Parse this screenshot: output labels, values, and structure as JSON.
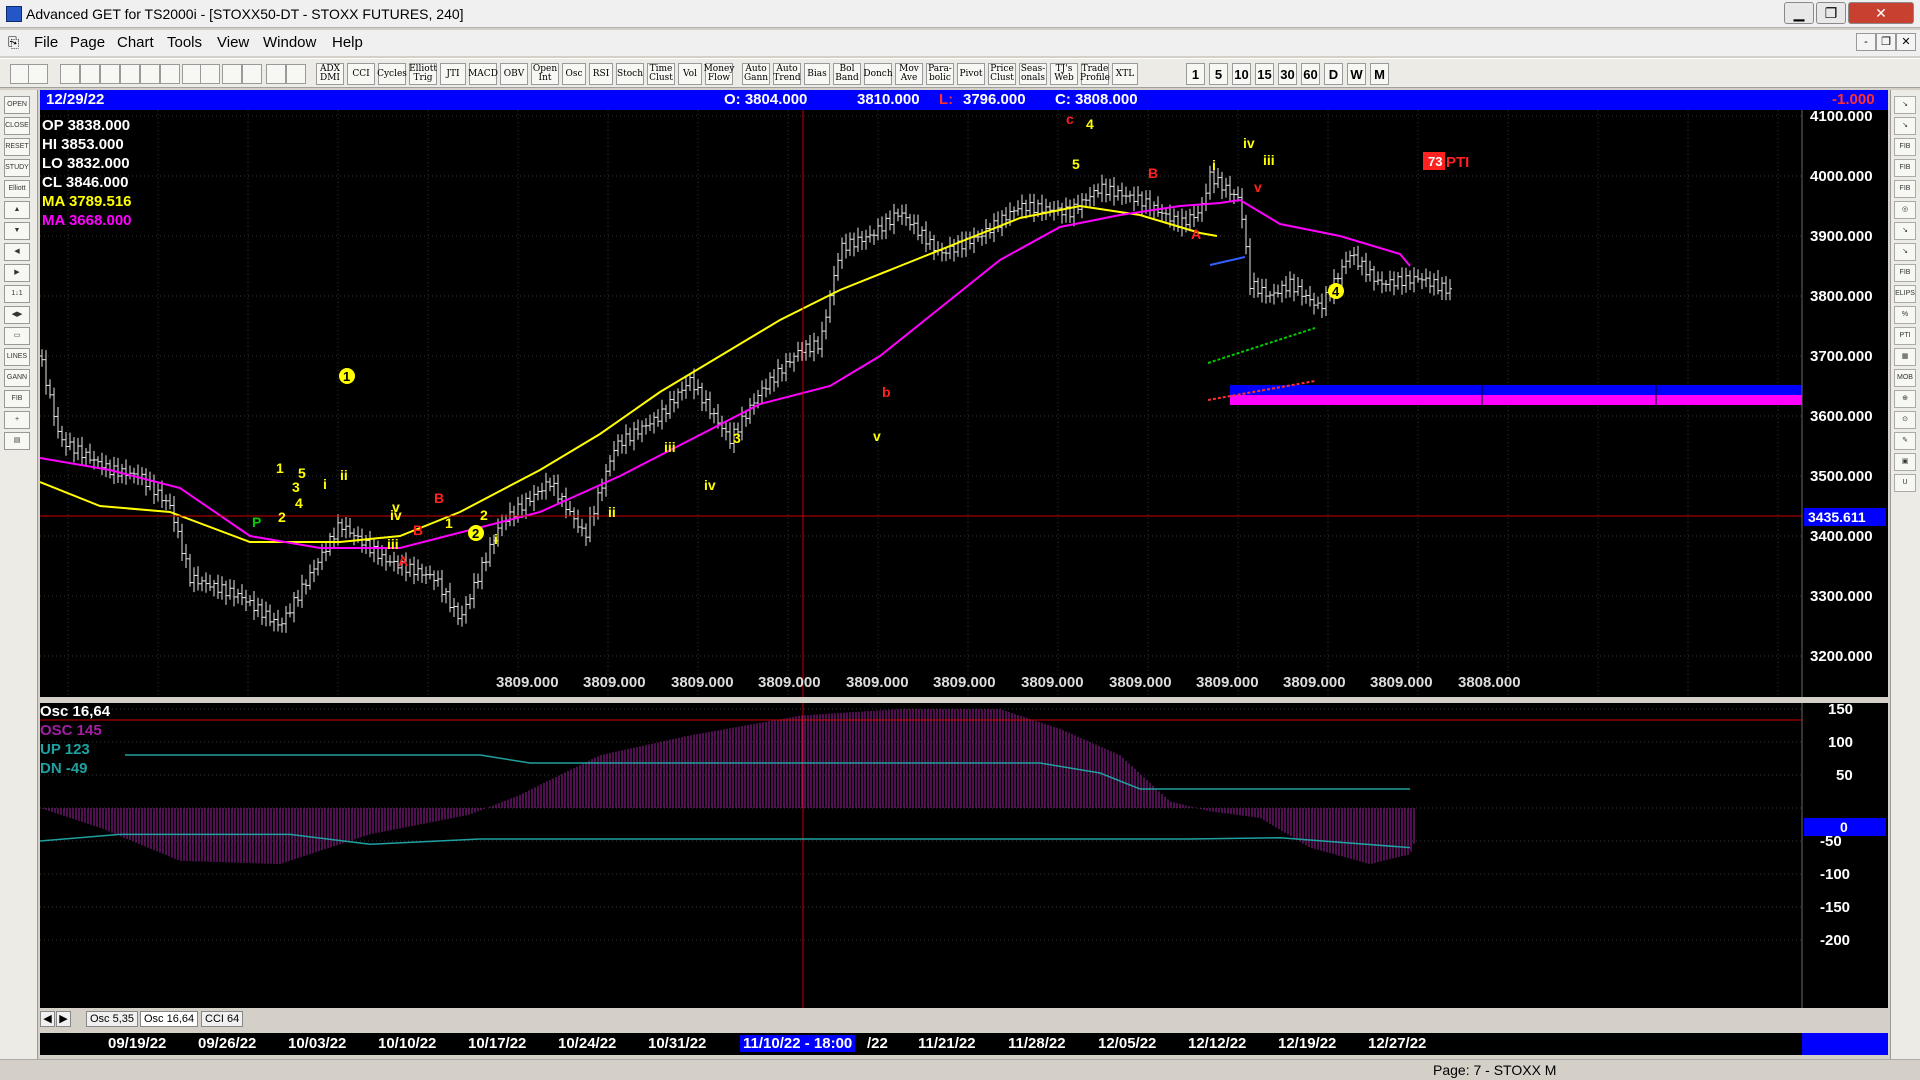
{
  "window": {
    "title": "Advanced GET for TS2000i - [STOXX50-DT - STOXX FUTURES, 240]",
    "min": "▁",
    "max": "❐",
    "close": "✕",
    "mdi_min": "-",
    "mdi_restore": "❐",
    "mdi_close": "✕"
  },
  "menu": [
    "File",
    "Page",
    "Chart",
    "Tools",
    "View",
    "Window",
    "Help"
  ],
  "toolbar": {
    "buttons": [
      "ADX DMI",
      "CCI",
      "Cycles",
      "Elliott Trig",
      "JTI",
      "MACD",
      "OBV",
      "Open Int",
      "Osc",
      "RSI",
      "Stoch",
      "Time Clust",
      "Vol",
      "Money Flow",
      "Auto Gann",
      "Auto Trend",
      "Bias",
      "Bol Band",
      "Donch",
      "Mov Ave",
      "Para-bolic",
      "Pivot",
      "Price Clust",
      "Seas-onals",
      "TJ's Web",
      "Trade Profile",
      "XTL"
    ],
    "intervals": [
      "1",
      "5",
      "10",
      "15",
      "30",
      "60",
      "D",
      "W",
      "M"
    ]
  },
  "left_tools": [
    "OPEN",
    "CLOSE",
    "RESET",
    "STUDY",
    "Elliott",
    "▲",
    "▼",
    "◀",
    "▶",
    "1↓1",
    "◀▶",
    "▭",
    "LINES",
    "GANN",
    "FIB",
    "+",
    "▤"
  ],
  "right_tools": [
    "↘",
    "↘",
    "FIB RET",
    "FIB EXT",
    "FIB TIME",
    "◎",
    "↘",
    "↘",
    "FIB",
    "ELIPS",
    "%",
    "PTI",
    "▦",
    "MOB",
    "⊕",
    "⊙",
    "✎",
    "▣",
    "U"
  ],
  "header": {
    "date": "12/29/22",
    "open": "O: 3804.000",
    "high": "3810.000",
    "low_label": "L:",
    "low": "3796.000",
    "close": "C: 3808.000",
    "change": "-1.000"
  },
  "info": {
    "op": "OP  3838.000",
    "hi": "HI   3853.000",
    "lo": "LO  3832.000",
    "cl": "CL  3846.000",
    "ma1": "MA  3789.516",
    "ma2": "MA  3668.000"
  },
  "price_axis": {
    "labels": [
      "4100.000",
      "4000.000",
      "3900.000",
      "3800.000",
      "3700.000",
      "3600.000",
      "3500.000",
      "3400.000",
      "3300.000",
      "3200.000"
    ],
    "cursor": "3435.611"
  },
  "bottom_vals": [
    "3809.000",
    "3809.000",
    "3809.000",
    "3809.000",
    "3809.000",
    "3809.000",
    "3809.000",
    "3809.000",
    "3809.000",
    "3809.000",
    "3809.000",
    "3808.000"
  ],
  "pti": {
    "value": "73",
    "label": "PTI"
  },
  "osc": {
    "title": "Osc 16,64",
    "osc": "OSC 145",
    "up": "UP   123",
    "dn": "DN   -49",
    "axis": [
      "150",
      "100",
      "50",
      "0",
      "-50",
      "-100",
      "-150",
      "-200"
    ],
    "zero": "0"
  },
  "tabs": [
    "Osc 5,35",
    "Osc 16,64",
    "CCI 64"
  ],
  "dates": [
    "09/19/22",
    "09/26/22",
    "10/03/22",
    "10/10/22",
    "10/17/22",
    "10/24/22",
    "10/31/22",
    "11/10/22 - 18:00",
    "/22",
    "11/21/22",
    "11/28/22",
    "12/05/22",
    "12/12/22",
    "12/19/22",
    "12/27/22"
  ],
  "status": "Page: 7 - STOXX M",
  "colors": {
    "chart_bg": "#000000",
    "header_bg": "#0000ff",
    "ma_fast": "#ffff00",
    "ma_slow": "#ff00ff",
    "osc": "#a020a0",
    "wave_yellow": "#ffff00",
    "wave_red": "#ff2020",
    "wave_green": "#00cc00",
    "cursor_line": "#cc0000"
  },
  "waves": [
    {
      "t": "P",
      "c": "#00cc00"
    },
    {
      "t": "2",
      "c": "#ffff00"
    },
    {
      "t": "1",
      "c": "#ffff00"
    },
    {
      "t": "3",
      "c": "#ffff00"
    },
    {
      "t": "4",
      "c": "#ffff00"
    },
    {
      "t": "5",
      "c": "#ffff00"
    },
    {
      "t": "ii",
      "c": "#ffff00"
    },
    {
      "t": "i",
      "c": "#ffff00"
    },
    {
      "t": "iv",
      "c": "#ffff00"
    },
    {
      "t": "iii",
      "c": "#ffff00"
    },
    {
      "t": "v",
      "c": "#ffff00"
    },
    {
      "t": "A",
      "c": "#ff2020"
    },
    {
      "t": "B",
      "c": "#ff2020"
    },
    {
      "t": "B",
      "c": "#ff2020"
    },
    {
      "t": "1",
      "c": "#ffff00"
    },
    {
      "t": "2",
      "c": "#ffff00"
    },
    {
      "t": "i",
      "c": "#ffff00"
    },
    {
      "t": "ii",
      "c": "#ffff00"
    },
    {
      "t": "iii",
      "c": "#ffff00"
    },
    {
      "t": "iv",
      "c": "#ffff00"
    },
    {
      "t": "3",
      "c": "#ffff00"
    },
    {
      "t": "v",
      "c": "#ffff00"
    },
    {
      "t": "b",
      "c": "#ff2020"
    },
    {
      "t": "a",
      "c": "#ff2020"
    },
    {
      "t": "c",
      "c": "#ff2020"
    },
    {
      "t": "4",
      "c": "#ffff00"
    },
    {
      "t": "5",
      "c": "#ffff00"
    },
    {
      "t": "B",
      "c": "#ff2020"
    },
    {
      "t": "A",
      "c": "#ff2020"
    },
    {
      "t": "ii",
      "c": "#ffff00"
    },
    {
      "t": "i",
      "c": "#ffff00"
    },
    {
      "t": "iv",
      "c": "#ffff00"
    },
    {
      "t": "iii",
      "c": "#ffff00"
    },
    {
      "t": "v",
      "c": "#ff2020"
    }
  ],
  "circled": [
    "1",
    "2",
    "4"
  ]
}
